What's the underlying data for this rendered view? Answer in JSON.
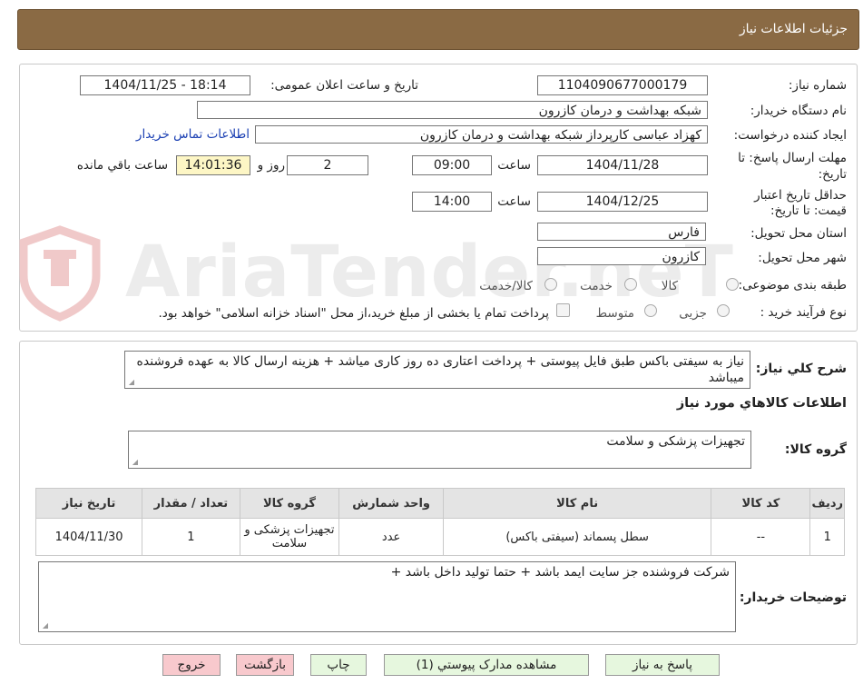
{
  "header": {
    "title": "جزئیات اطلاعات نیاز"
  },
  "form": {
    "need_number_label": "شماره نیاز:",
    "need_number": "1104090677000179",
    "announce_label": "تاریخ و ساعت اعلان عمومی:",
    "announce_value": "1404/11/25 - 18:14",
    "buyer_org_label": "نام دستگاه خریدار:",
    "buyer_org": "شبکه بهداشت و درمان کازرون",
    "creator_label": "ایجاد کننده درخواست:",
    "creator": "کهزاد عباسی کارپرداز شبکه بهداشت و درمان کازرون",
    "contact_link": "اطلاعات تماس خریدار",
    "deadline_label_1": "مهلت ارسال پاسخ: تا",
    "deadline_label_2": "تاریخ:",
    "deadline_date": "1404/11/28",
    "time_label": "ساعت",
    "deadline_time": "09:00",
    "days_value": "2",
    "days_label": "روز و",
    "remaining_time": "14:01:36",
    "remaining_label": "ساعت باقي مانده",
    "validity_label_1": "حداقل تاریخ اعتبار",
    "validity_label_2": "قیمت: تا تاریخ:",
    "validity_date": "1404/12/25",
    "validity_time": "14:00",
    "province_label": "استان محل تحویل:",
    "province": "فارس",
    "city_label": "شهر محل تحویل:",
    "city": "کازرون",
    "category_label": "طبقه بندی موضوعی:",
    "category_options": [
      "کالا",
      "خدمت",
      "کالا/خدمت"
    ],
    "process_label": "نوع فرآیند خرید :",
    "process_options": [
      "جزیی",
      "متوسط"
    ],
    "treasury_note": "پرداخت تمام یا بخشی از مبلغ خرید،از محل \"اسناد خزانه اسلامی\" خواهد بود."
  },
  "watermark": {
    "text": "AriaTender.neT"
  },
  "details": {
    "description_label": "شرح کلي نياز:",
    "description": "نیاز به سیفتی باکس طبق فایل پیوستی + پرداخت اعتاری ده روز کاری میاشد + هزینه ارسال کالا به عهده فروشنده میباشد",
    "goods_info_title": "اطلاعات کالاهاي مورد نياز",
    "goods_group_label": "گروه کالا:",
    "goods_group": "تجهیزات پزشکی و سلامت"
  },
  "table": {
    "headers": [
      "رديف",
      "کد کالا",
      "نام کالا",
      "واحد شمارش",
      "گروه کالا",
      "تعداد / مقدار",
      "تاريخ نياز"
    ],
    "rows": [
      [
        "1",
        "--",
        "سطل پسماند (سیفتی باکس)",
        "عدد",
        "تجهیزات پزشکی و سلامت",
        "1",
        "1404/11/30"
      ]
    ]
  },
  "buyer_notes": {
    "label": "توضيحات خريدار:",
    "text": "شرکت فروشنده جز سایت ایمد باشد + حتما تولید داخل باشد +"
  },
  "buttons": {
    "reply": "پاسخ به نياز",
    "attachments": "مشاهده مدارک پيوستي (1)",
    "print": "چاپ",
    "back": "بازگشت",
    "exit": "خروج"
  }
}
